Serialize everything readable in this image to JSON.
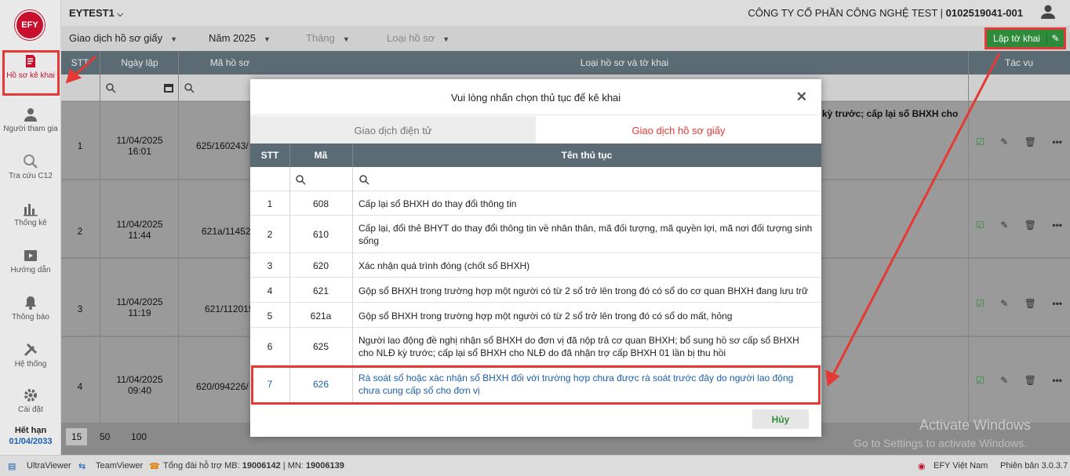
{
  "sidebar": {
    "logo": "EFY",
    "items": [
      {
        "label": "Hồ sơ kê khai",
        "icon": "document-edit-icon"
      },
      {
        "label": "Người tham gia",
        "icon": "person-icon"
      },
      {
        "label": "Tra cứu C12",
        "icon": "search-icon"
      },
      {
        "label": "Thống kê",
        "icon": "bar-chart-icon"
      },
      {
        "label": "Hướng dẫn",
        "icon": "video-guide-icon"
      },
      {
        "label": "Thông báo",
        "icon": "bell-icon"
      },
      {
        "label": "Hệ thống",
        "icon": "tools-icon"
      },
      {
        "label": "Cài đặt",
        "icon": "gear-icon"
      }
    ],
    "expiry_label": "Hết hạn",
    "expiry_date": "01/04/2033"
  },
  "header": {
    "tenant": "EYTEST1",
    "company_name": "CÔNG TY CỔ PHẦN CÔNG NGHỆ TEST",
    "tax_code": "0102519041-001"
  },
  "filters": {
    "type": "Giao dịch hồ sơ giấy",
    "year": "Năm 2025",
    "month": "Tháng",
    "record_type": "Loại hồ sơ",
    "create_button": "Lập tờ khai"
  },
  "table": {
    "headers": {
      "stt": "STT",
      "date": "Ngày lập",
      "code": "Mã hồ sơ",
      "type": "Loại hồ sơ và tờ khai",
      "actions": "Tác vụ"
    },
    "row1_type_snippet": "kỳ trước; cấp lại sổ BHXH cho",
    "rows": [
      {
        "stt": "1",
        "date": "11/04/2025",
        "time": "16:01",
        "code": "625/160243/"
      },
      {
        "stt": "2",
        "date": "11/04/2025",
        "time": "11:44",
        "code": "621a/11452"
      },
      {
        "stt": "3",
        "date": "11/04/2025",
        "time": "11:19",
        "code": "621/112015"
      },
      {
        "stt": "4",
        "date": "11/04/2025",
        "time": "09:40",
        "code": "620/094226/"
      }
    ]
  },
  "pager": {
    "sizes": [
      "15",
      "50",
      "100"
    ],
    "active": "15"
  },
  "windows_watermark": {
    "title": "Activate Windows",
    "subtitle": "Go to Settings to activate Windows."
  },
  "footer": {
    "ultraviewer": "UltraViewer",
    "teamviewer": "TeamViewer",
    "hotline_label": "Tổng đài hỗ trợ MB:",
    "hotline_mb": "19006142",
    "hotline_sep": "| MN:",
    "hotline_mn": "19006139",
    "brand": "EFY Việt Nam",
    "version": "Phiên bản 3.0.3.7"
  },
  "modal": {
    "title": "Vui lòng nhấn chọn thủ tục để kê khai",
    "tabs": [
      "Giao dịch điện tử",
      "Giao dịch hồ sơ giấy"
    ],
    "active_tab": "Giao dịch hồ sơ giấy",
    "headers": {
      "stt": "STT",
      "code": "Mã",
      "name": "Tên thủ tục"
    },
    "procedures": [
      {
        "stt": "1",
        "code": "608",
        "name": "Cấp lại sổ BHXH do thay đổi thông tin"
      },
      {
        "stt": "2",
        "code": "610",
        "name": "Cấp lại, đổi thẻ BHYT do thay đổi thông tin về nhân thân, mã đối tượng, mã quyền lợi, mã nơi đối tượng sinh sống"
      },
      {
        "stt": "3",
        "code": "620",
        "name": "Xác nhận quá trình đóng (chốt sổ BHXH)"
      },
      {
        "stt": "4",
        "code": "621",
        "name": "Gộp sổ BHXH trong trường hợp một người có từ 2 sổ trở lên trong đó có sổ do cơ quan BHXH đang lưu trữ"
      },
      {
        "stt": "5",
        "code": "621a",
        "name": "Gộp sổ BHXH trong trường hợp một người có từ 2 sổ trở lên trong đó có sổ do mất, hỏng"
      },
      {
        "stt": "6",
        "code": "625",
        "name": "Người lao động đề nghị nhận sổ BHXH do đơn vị đã nộp trả cơ quan BHXH; bổ sung hồ sơ cấp sổ BHXH cho NLĐ kỳ trước; cấp lại sổ BHXH cho NLĐ do đã nhận trợ cấp BHXH 01 lần bị thu hồi"
      },
      {
        "stt": "7",
        "code": "626",
        "name": "Rà soát sổ hoặc xác nhận sổ BHXH đối với trường hợp chưa được rà soát trước đây do người lao động chưa cung cấp sổ cho đơn vị"
      }
    ],
    "selected_stt": "7",
    "cancel_label": "Hủy"
  }
}
